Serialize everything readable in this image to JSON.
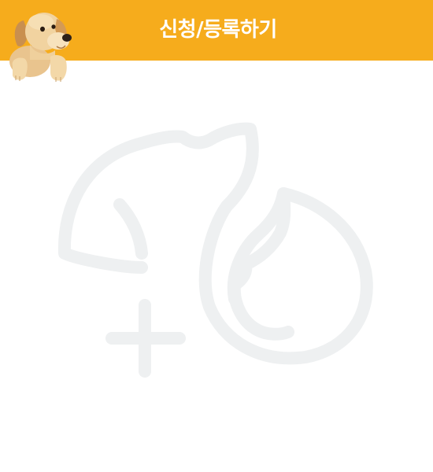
{
  "header": {
    "title": "신청/등록하기",
    "background_color": "#f6ac1c",
    "title_color": "#ffffff"
  },
  "mascot": {
    "icon": "puppy-mascot-icon"
  },
  "illustration": {
    "icon": "pet-add-placeholder-icon",
    "stroke_color": "#eef0f1"
  }
}
